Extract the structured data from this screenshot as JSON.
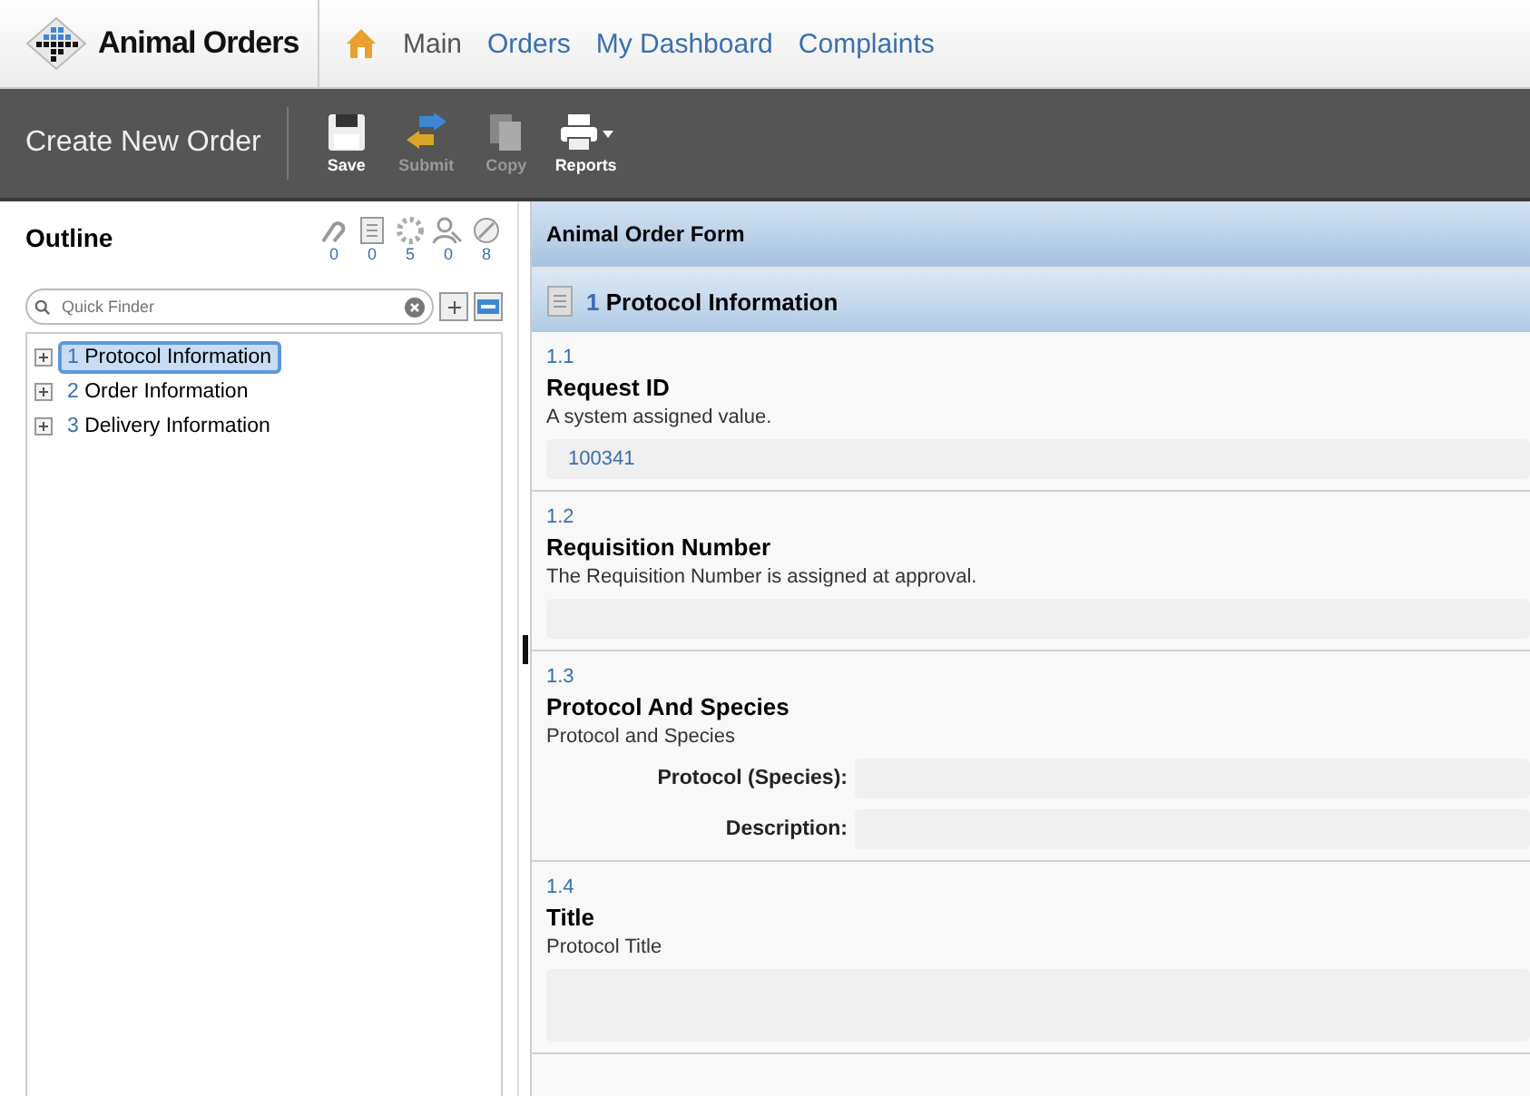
{
  "app": {
    "title": "Animal Orders"
  },
  "nav": [
    {
      "label": "Main",
      "selected": true
    },
    {
      "label": "Orders",
      "selected": false
    },
    {
      "label": "My Dashboard",
      "selected": false
    },
    {
      "label": "Complaints",
      "selected": false
    }
  ],
  "toolbar": {
    "title": "Create New Order",
    "buttons": [
      {
        "kind": "save",
        "label": "Save",
        "disabled": false
      },
      {
        "kind": "submit",
        "label": "Submit",
        "disabled": true
      },
      {
        "kind": "copy",
        "label": "Copy",
        "disabled": true
      },
      {
        "kind": "reports",
        "label": "Reports",
        "disabled": false
      }
    ]
  },
  "outline": {
    "title": "Outline",
    "counters": [
      {
        "kind": "link",
        "count": "0"
      },
      {
        "kind": "list",
        "count": "0"
      },
      {
        "kind": "spinner",
        "count": "5"
      },
      {
        "kind": "people",
        "count": "0"
      },
      {
        "kind": "blocked",
        "count": "8"
      }
    ],
    "search": {
      "placeholder": "Quick Finder"
    },
    "items": [
      {
        "number": "1",
        "label": "Protocol Information",
        "selected": true
      },
      {
        "number": "2",
        "label": "Order Information",
        "selected": false
      },
      {
        "number": "3",
        "label": "Delivery Information",
        "selected": false
      }
    ]
  },
  "form": {
    "title": "Animal Order Form",
    "section": {
      "number": "1",
      "title": "Protocol Information"
    },
    "questions": [
      {
        "kind": "field",
        "number": "1.1",
        "title": "Request ID",
        "description": "A system assigned value.",
        "value": "100341"
      },
      {
        "kind": "field",
        "number": "1.2",
        "title": "Requisition Number",
        "description": "The Requisition Number is assigned at approval."
      },
      {
        "kind": "labeled",
        "number": "1.3",
        "title": "Protocol And Species",
        "description": "Protocol and Species",
        "fields": [
          {
            "label": "Protocol (Species):"
          },
          {
            "label": "Description:"
          }
        ]
      },
      {
        "kind": "area",
        "number": "1.4",
        "title": "Title",
        "description": "Protocol Title"
      }
    ]
  }
}
